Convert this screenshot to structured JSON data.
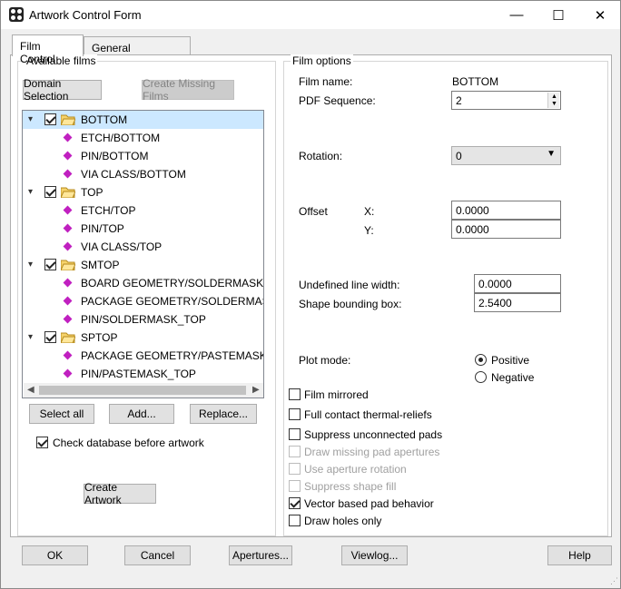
{
  "window": {
    "title": "Artwork Control Form",
    "minimize": "—",
    "maximize": "☐",
    "close": "✕"
  },
  "tabs": [
    {
      "label": "Film Control"
    },
    {
      "label": "General Parameters"
    }
  ],
  "available_films": {
    "group_label": "Available films",
    "domain_selection": "Domain Selection",
    "create_missing": "Create Missing Films",
    "tree": [
      {
        "label": "BOTTOM",
        "type": "film"
      },
      {
        "label": "ETCH/BOTTOM",
        "type": "layer"
      },
      {
        "label": "PIN/BOTTOM",
        "type": "layer"
      },
      {
        "label": "VIA CLASS/BOTTOM",
        "type": "layer"
      },
      {
        "label": "TOP",
        "type": "film"
      },
      {
        "label": "ETCH/TOP",
        "type": "layer"
      },
      {
        "label": "PIN/TOP",
        "type": "layer"
      },
      {
        "label": "VIA CLASS/TOP",
        "type": "layer"
      },
      {
        "label": "SMTOP",
        "type": "film"
      },
      {
        "label": "BOARD GEOMETRY/SOLDERMASK_TOP",
        "type": "layer"
      },
      {
        "label": "PACKAGE GEOMETRY/SOLDERMASK_TOP",
        "type": "layer"
      },
      {
        "label": "PIN/SOLDERMASK_TOP",
        "type": "layer"
      },
      {
        "label": "SPTOP",
        "type": "film"
      },
      {
        "label": "PACKAGE GEOMETRY/PASTEMASK_TOP",
        "type": "layer"
      },
      {
        "label": "PIN/PASTEMASK_TOP",
        "type": "layer"
      }
    ],
    "select_all": "Select all",
    "add": "Add...",
    "replace": "Replace...",
    "check_db": "Check database before artwork",
    "create_artwork": "Create Artwork"
  },
  "film_options": {
    "group_label": "Film options",
    "film_name_label": "Film name:",
    "film_name_value": "BOTTOM",
    "pdf_sequence_label": "PDF Sequence:",
    "pdf_sequence_value": "2",
    "rotation_label": "Rotation:",
    "rotation_value": "0",
    "offset_label": "Offset",
    "x_label": "X:",
    "x_value": "0.0000",
    "y_label": "Y:",
    "y_value": "0.0000",
    "undef_width_label": "Undefined line width:",
    "undef_width_value": "0.0000",
    "shape_box_label": "Shape bounding box:",
    "shape_box_value": "2.5400",
    "plot_mode_label": "Plot mode:",
    "positive": "Positive",
    "negative": "Negative",
    "checkboxes": [
      {
        "label": "Film mirrored",
        "checked": false,
        "enabled": true
      },
      {
        "label": "Full contact thermal-reliefs",
        "checked": false,
        "enabled": true
      },
      {
        "label": "Suppress unconnected pads",
        "checked": false,
        "enabled": true
      },
      {
        "label": "Draw missing pad apertures",
        "checked": false,
        "enabled": false
      },
      {
        "label": "Use aperture rotation",
        "checked": false,
        "enabled": false
      },
      {
        "label": "Suppress shape fill",
        "checked": false,
        "enabled": false
      },
      {
        "label": "Vector based pad behavior",
        "checked": true,
        "enabled": true
      },
      {
        "label": "Draw holes only",
        "checked": false,
        "enabled": true
      }
    ]
  },
  "footer": {
    "ok": "OK",
    "cancel": "Cancel",
    "apertures": "Apertures...",
    "viewlog": "Viewlog...",
    "help": "Help"
  }
}
